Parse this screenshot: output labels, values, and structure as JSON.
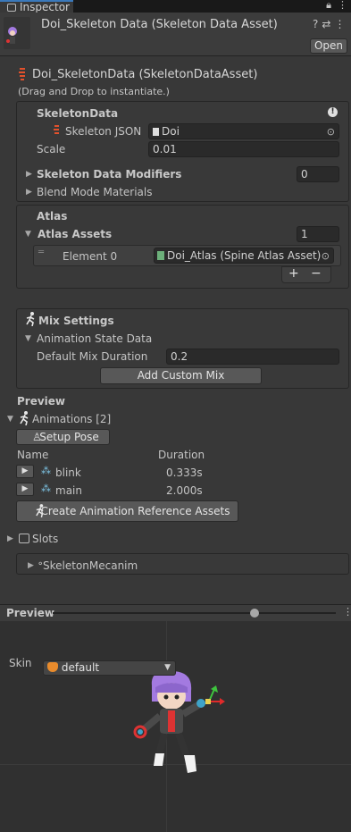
{
  "tab": {
    "label": "Inspector"
  },
  "header": {
    "title": "Doi_Skeleton Data (Skeleton Data Asset)",
    "open_label": "Open"
  },
  "asset": {
    "title": "Doi_SkeletonData (SkeletonDataAsset)",
    "hint": "(Drag and Drop to instantiate.)"
  },
  "skeleton_data": {
    "heading": "SkeletonData",
    "json_label": "Skeleton JSON",
    "json_value": "Doi",
    "scale_label": "Scale",
    "scale_value": "0.01",
    "modifiers_label": "Skeleton Data Modifiers",
    "modifiers_count": "0",
    "blend_label": "Blend Mode Materials"
  },
  "atlas": {
    "heading": "Atlas",
    "assets_label": "Atlas Assets",
    "assets_count": "1",
    "element_label": "Element 0",
    "element_value": "Doi_Atlas (Spine Atlas Asset)",
    "plus": "+",
    "minus": "−"
  },
  "mix": {
    "heading": "Mix Settings",
    "state_label": "Animation State Data",
    "duration_label": "Default Mix Duration",
    "duration_value": "0.2",
    "add_label": "Add Custom Mix"
  },
  "preview": {
    "heading": "Preview",
    "animations_label": "Animations [2]",
    "setup_pose_label": "Setup Pose",
    "col_name": "Name",
    "col_duration": "Duration",
    "animations": [
      {
        "name": "blink",
        "duration": "0.333s"
      },
      {
        "name": "main",
        "duration": "2.000s"
      }
    ],
    "create_label": "Create Animation Reference Assets",
    "slots_label": "Slots",
    "mecanim_label": "SkeletonMecanim"
  },
  "preview_panel": {
    "title": "Preview",
    "skin_label": "Skin",
    "skin_value": "default",
    "slider_fraction": 0.72
  },
  "colors": {
    "accent": "#3a79bb",
    "spine_red": "#e2512c",
    "hair": "#a37ae0"
  }
}
